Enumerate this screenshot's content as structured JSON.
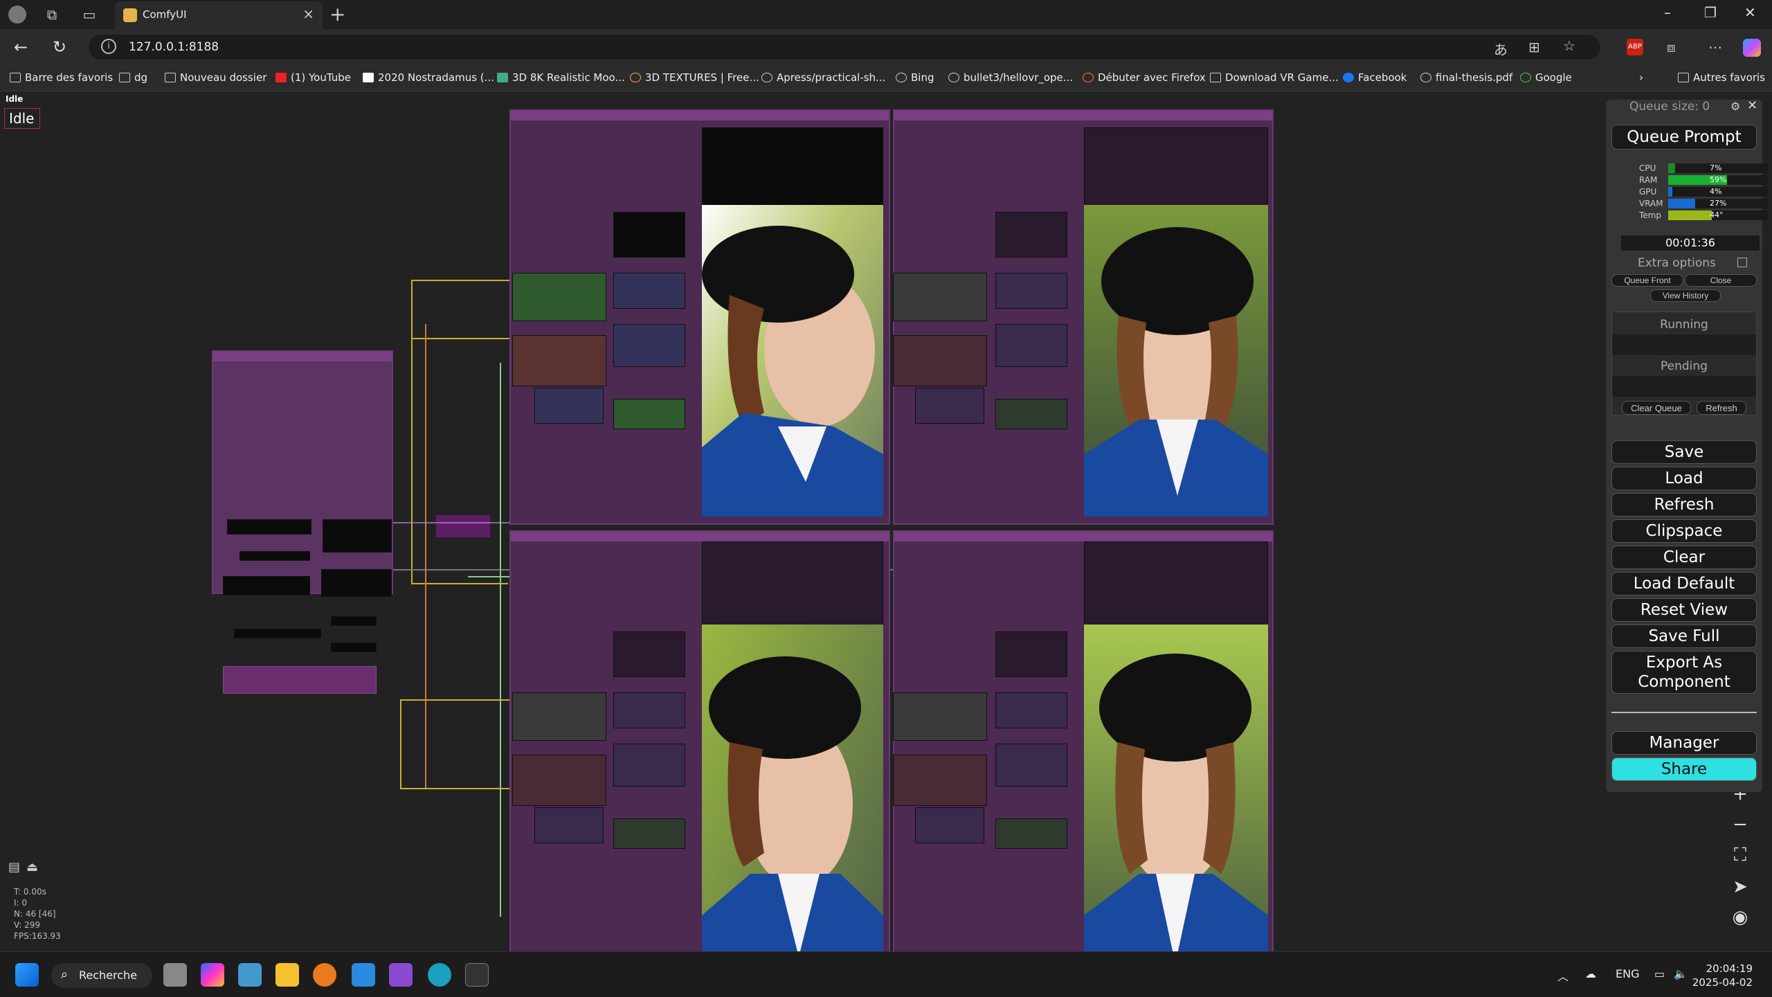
{
  "browser": {
    "tab_title": "ComfyUI",
    "url": "127.0.0.1:8188",
    "bookmarks": [
      "Barre des favoris",
      "dg",
      "Nouveau dossier",
      "(1) YouTube",
      "2020 Nostradamus (...",
      "3D 8K Realistic Moo...",
      "3D TEXTURES | Free...",
      "Apress/practical-sh...",
      "Bing",
      "bullet3/hellovr_ope...",
      "Débuter avec Firefox",
      "Download VR Game...",
      "Facebook",
      "final-thesis.pdf",
      "Google"
    ],
    "other_bookmarks": "Autres favoris"
  },
  "canvas": {
    "status_line": "Idle",
    "status_badge": "Idle",
    "stats": [
      "T: 0.00s",
      "I: 0",
      "N: 46 [46]",
      "V: 299",
      "FPS:163.93"
    ]
  },
  "panel": {
    "queue_size": "Queue size: 0",
    "queue_prompt": "Queue Prompt",
    "resources": [
      {
        "label": "CPU",
        "value": "7%",
        "pct": 7,
        "color": "#1e8a2a"
      },
      {
        "label": "RAM",
        "value": "59%",
        "pct": 59,
        "color": "#18b030"
      },
      {
        "label": "GPU",
        "value": "4%",
        "pct": 4,
        "color": "#1a6ad0"
      },
      {
        "label": "VRAM",
        "value": "27%",
        "pct": 27,
        "color": "#1a6ad0"
      },
      {
        "label": "Temp",
        "value": "44°",
        "pct": 44,
        "color": "#9ab818"
      }
    ],
    "timer": "00:01:36",
    "extra_options": "Extra options",
    "queue_front": "Queue Front",
    "close": "Close",
    "view_history": "View History",
    "running": "Running",
    "pending": "Pending",
    "clear_queue": "Clear Queue",
    "refresh_small": "Refresh",
    "buttons": {
      "save": "Save",
      "load": "Load",
      "refresh": "Refresh",
      "clipspace": "Clipspace",
      "clear": "Clear",
      "load_default": "Load Default",
      "reset_view": "Reset View",
      "save_full": "Save Full",
      "export_1": "Export As",
      "export_2": "Component",
      "manager": "Manager",
      "share": "Share"
    },
    "share_color": "#2ee0e0"
  },
  "taskbar": {
    "search": "Recherche",
    "lang": "ENG",
    "time": "20:04:19",
    "date": "2025-04-02"
  }
}
